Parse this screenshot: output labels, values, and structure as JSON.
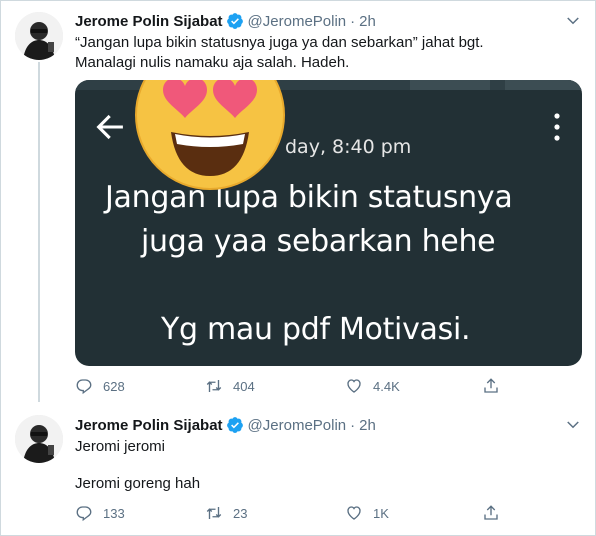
{
  "tweets": [
    {
      "name": "Jerome Polin Sijabat",
      "handle": "@JeromePolin",
      "separator": "·",
      "time": "2h",
      "text_lines": [
        "“Jangan lupa bikin statusnya juga ya dan sebarkan” jahat bgt.",
        "Manalagi nulis namaku aja salah. Hadeh."
      ],
      "media": {
        "timestamp": "day, 8:40 pm",
        "lines": [
          "Jangan lupa bikin statusnya",
          "juga yaa sebarkan hehe",
          "Yg mau pdf Motivasi."
        ],
        "emoji_icon": "heart-eyes-emoji"
      },
      "actions": {
        "replies": "628",
        "retweets": "404",
        "likes": "4.4K"
      }
    },
    {
      "name": "Jerome Polin Sijabat",
      "handle": "@JeromePolin",
      "separator": "·",
      "time": "2h",
      "text_lines": [
        "Jeromi jeromi",
        "Jeromi goreng hah"
      ],
      "actions": {
        "replies": "133",
        "retweets": "23",
        "likes": "1K"
      }
    }
  ],
  "colors": {
    "verified": "#1da1f2",
    "secondary_text": "#5b7083",
    "media_bg": "#223035"
  },
  "icons": {
    "verified": "verified-badge-icon",
    "caret": "chevron-down-icon",
    "reply": "reply-icon",
    "retweet": "retweet-icon",
    "like": "heart-icon",
    "share": "share-icon"
  }
}
